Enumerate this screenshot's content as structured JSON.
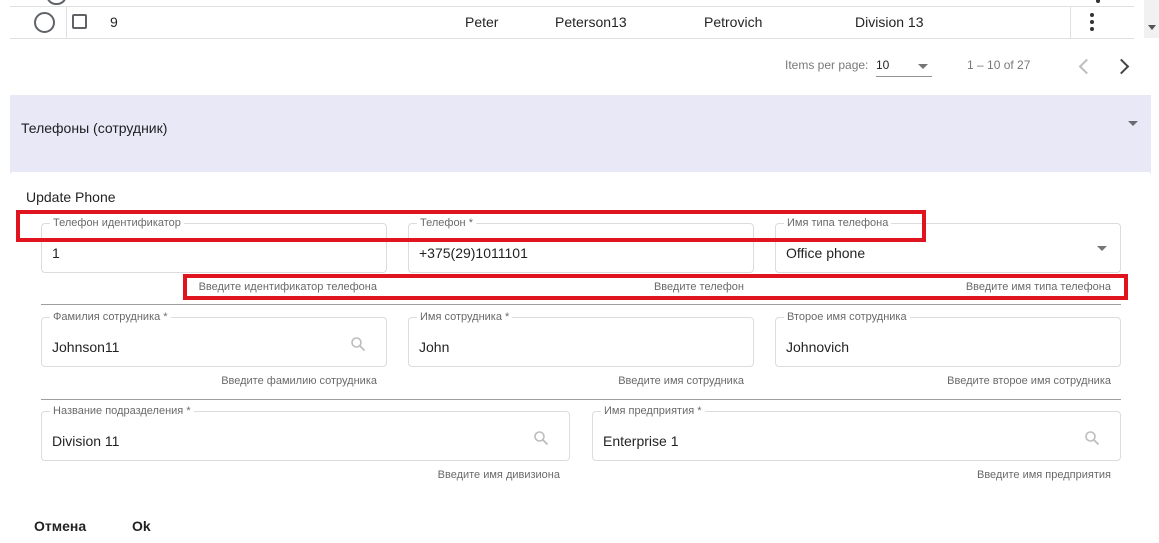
{
  "table": {
    "row": {
      "number": "9",
      "first_name": "Peter",
      "last_name": "Peterson13",
      "middle_name": "Petrovich",
      "division": "Division 13"
    }
  },
  "paginator": {
    "items_per_page_label": "Items per page:",
    "items_per_page_value": "10",
    "range_label": "1 – 10 of 27"
  },
  "panel": {
    "title": "Телефоны (сотрудник)"
  },
  "form": {
    "title": "Update Phone",
    "phone_id": {
      "label": "Телефон идентификатор",
      "value": "1",
      "hint": "Введите идентификатор телефона"
    },
    "phone": {
      "label": "Телефон *",
      "value": "+375(29)1011101",
      "hint": "Введите телефон"
    },
    "phone_type": {
      "label": "Имя типа телефона",
      "value": "Office phone",
      "hint": "Введите имя типа телефона"
    },
    "last_name": {
      "label": "Фамилия сотрудника *",
      "value": "Johnson11",
      "hint": "Введите фамилию сотрудника"
    },
    "first_name": {
      "label": "Имя сотрудника *",
      "value": "John",
      "hint": "Введите имя сотрудника"
    },
    "middle_name": {
      "label": "Второе имя сотрудника",
      "value": "Johnovich",
      "hint": "Введите второе имя сотрудника"
    },
    "division": {
      "label": "Название подразделения *",
      "value": "Division 11",
      "hint": "Введите имя дивизиона"
    },
    "enterprise": {
      "label": "Имя предприятия *",
      "value": "Enterprise 1",
      "hint": "Введите имя предприятия"
    }
  },
  "actions": {
    "cancel_label": "Отмена",
    "ok_label": "Ok"
  },
  "colors": {
    "highlight": "#e0141e",
    "panel_background": "#e8e8f7"
  },
  "icons": [
    "radio-icon",
    "checkbox-icon",
    "more-vert-icon",
    "dropdown-caret-icon",
    "chevron-left-icon",
    "chevron-right-icon",
    "search-icon"
  ]
}
